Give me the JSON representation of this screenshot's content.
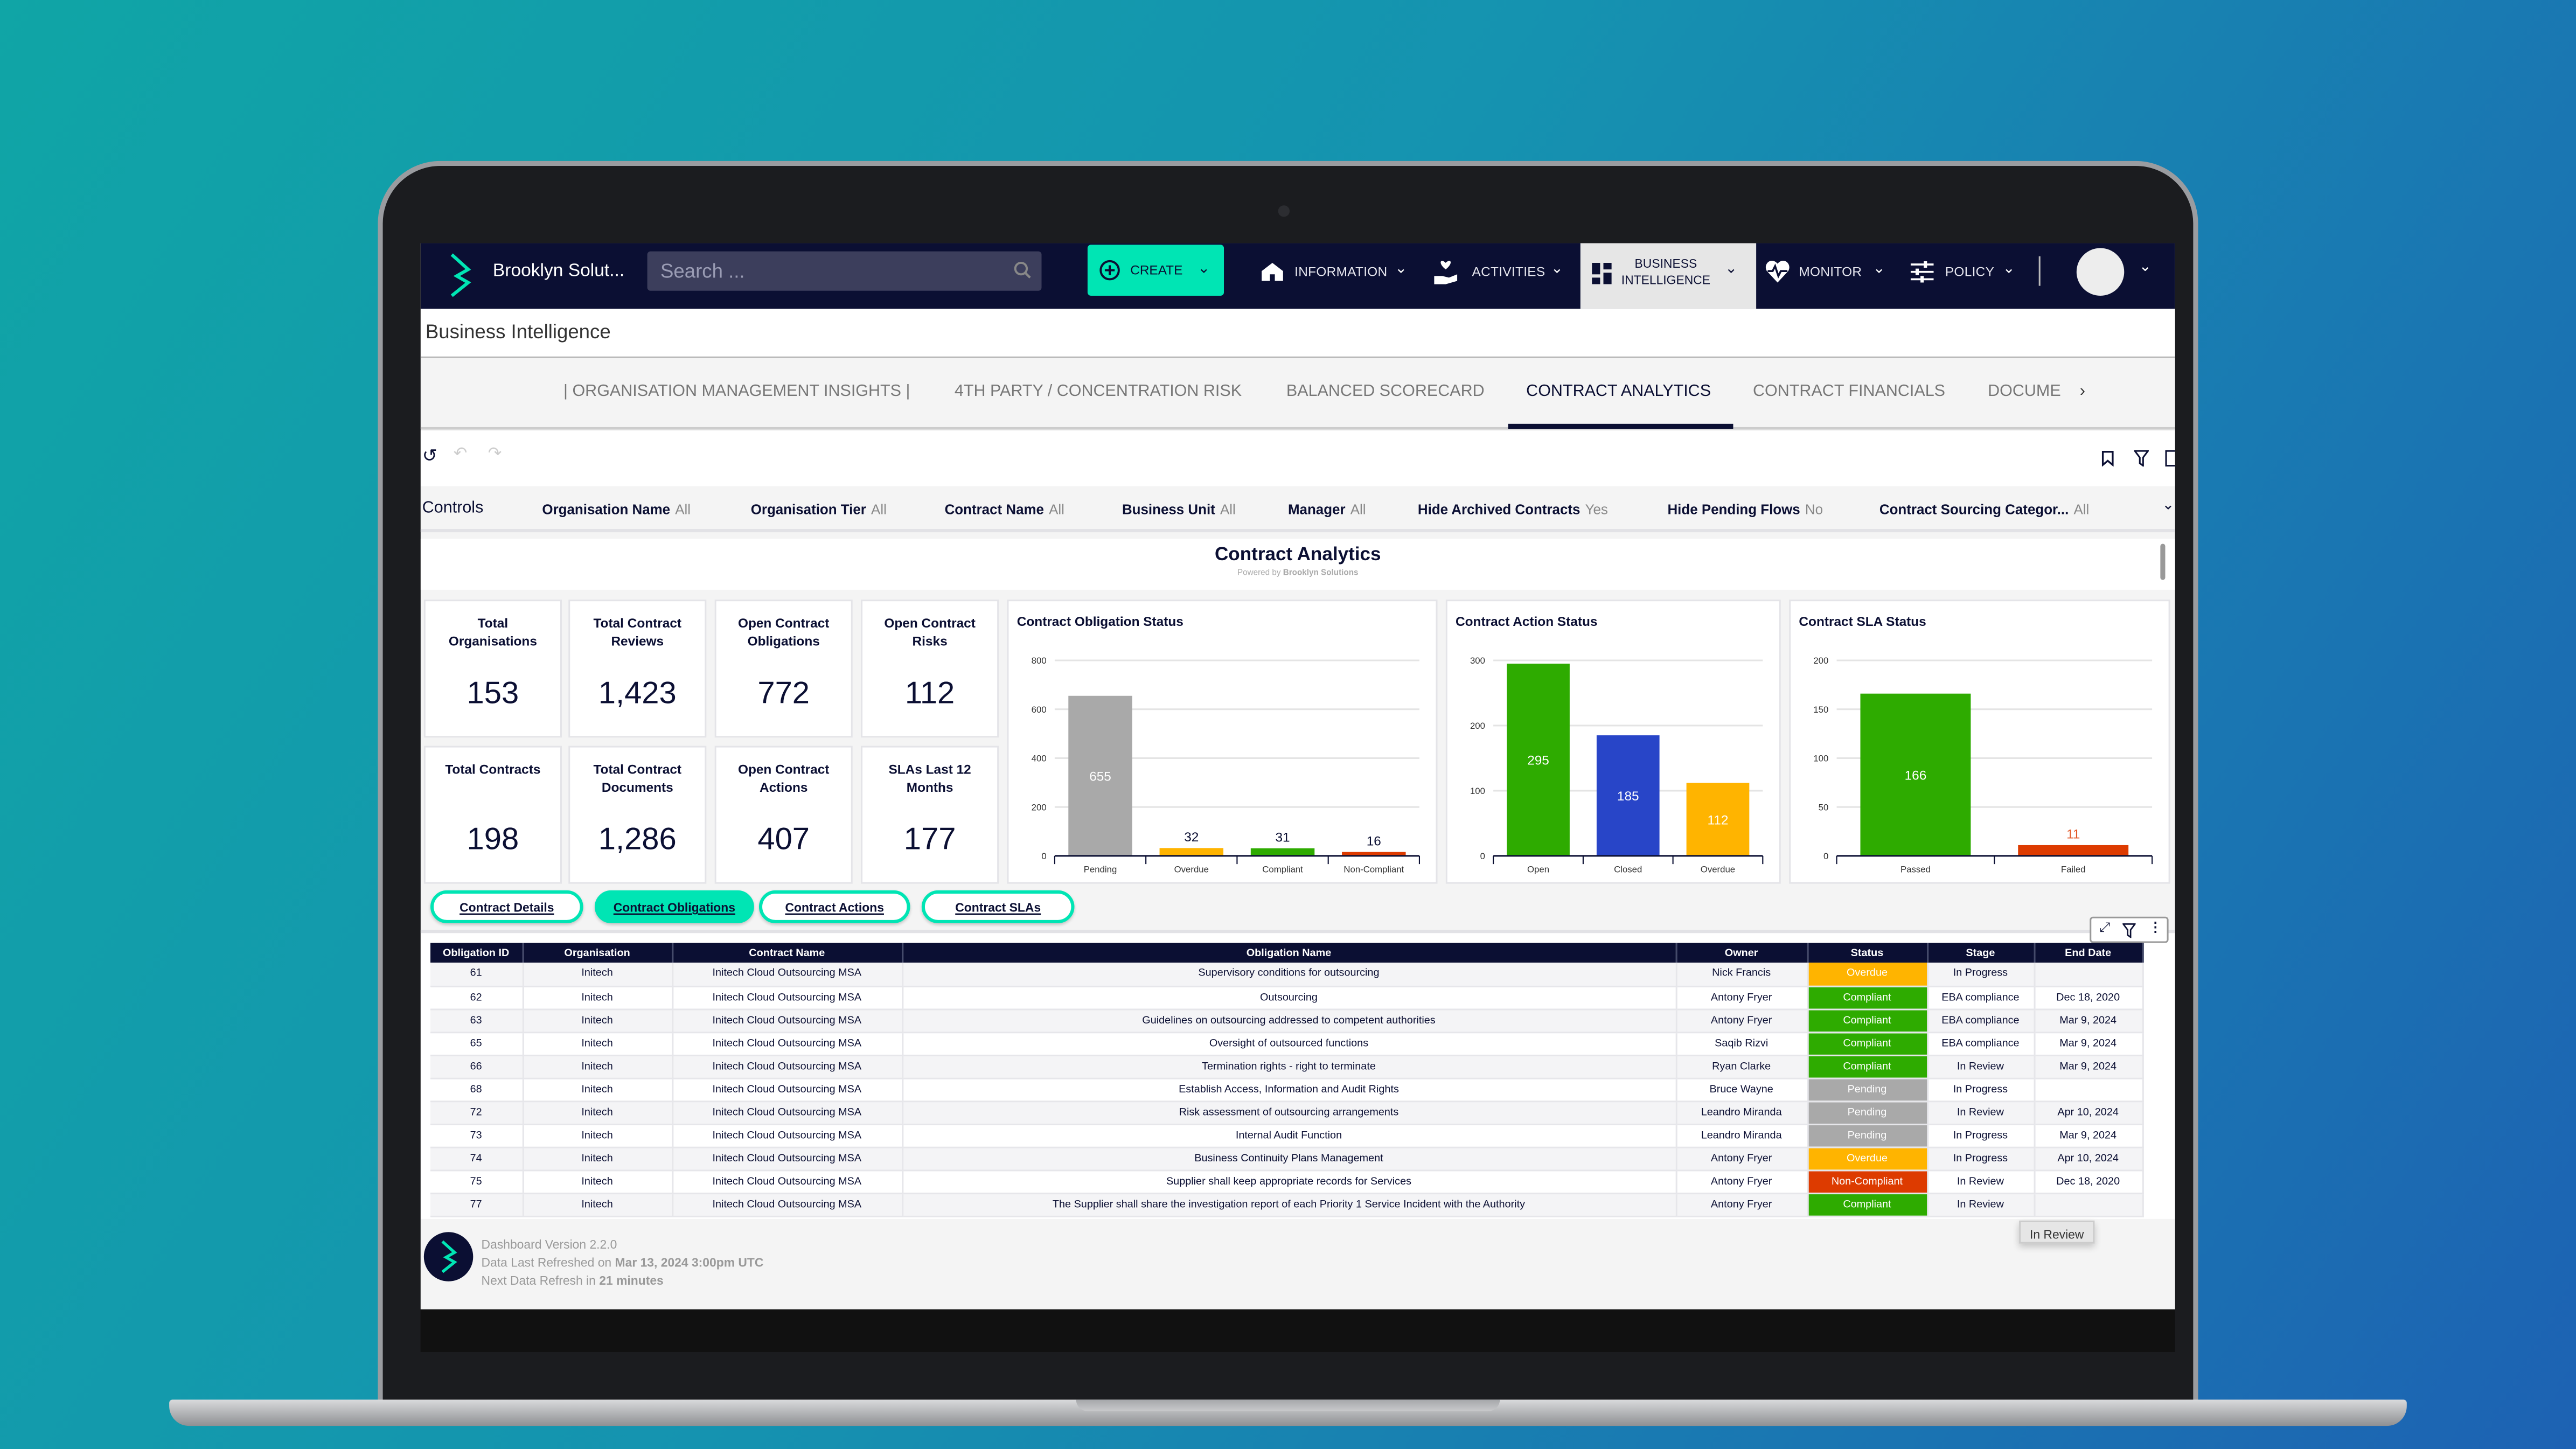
{
  "app": {
    "org_name": "Brooklyn Solut...",
    "search_placeholder": "Search ...",
    "create_label": "CREATE",
    "nav": [
      {
        "label": "INFORMATION",
        "icon": "home-icon"
      },
      {
        "label": "ACTIVITIES",
        "icon": "hand-heart-icon"
      },
      {
        "label": "BUSINESS INTELLIGENCE",
        "icon": "dashboard-icon",
        "active": true
      },
      {
        "label": "MONITOR",
        "icon": "heartbeat-icon"
      },
      {
        "label": "POLICY",
        "icon": "sliders-icon"
      }
    ]
  },
  "page_title": "Business Intelligence",
  "tabs": [
    "| ORGANISATION MANAGEMENT INSIGHTS |",
    "4TH PARTY / CONCENTRATION RISK",
    "BALANCED SCORECARD",
    "CONTRACT ANALYTICS",
    "CONTRACT FINANCIALS",
    "DOCUME"
  ],
  "active_tab": "CONTRACT ANALYTICS",
  "controls": {
    "label": "Controls",
    "filters": [
      {
        "name": "Organisation Name",
        "value": "All"
      },
      {
        "name": "Organisation Tier",
        "value": "All"
      },
      {
        "name": "Contract Name",
        "value": "All"
      },
      {
        "name": "Business Unit",
        "value": "All"
      },
      {
        "name": "Manager",
        "value": "All"
      },
      {
        "name": "Hide Archived Contracts",
        "value": "Yes"
      },
      {
        "name": "Hide Pending Flows",
        "value": "No"
      },
      {
        "name": "Contract Sourcing Categor...",
        "value": "All"
      }
    ]
  },
  "dashboard": {
    "title": "Contract Analytics",
    "powered_prefix": "Powered by",
    "powered_brand": "Brooklyn Solutions"
  },
  "kpis": [
    {
      "label": "Total Organisations",
      "value": "153"
    },
    {
      "label": "Total Contract Reviews",
      "value": "1,423"
    },
    {
      "label": "Open Contract Obligations",
      "value": "772"
    },
    {
      "label": "Open Contract Risks",
      "value": "112"
    },
    {
      "label": "Total Contracts",
      "value": "198"
    },
    {
      "label": "Total Contract Documents",
      "value": "1,286"
    },
    {
      "label": "Open Contract Actions",
      "value": "407"
    },
    {
      "label": "SLAs Last 12 Months",
      "value": "177"
    }
  ],
  "chart_data": [
    {
      "type": "bar",
      "title": "Contract Obligation Status",
      "categories": [
        "Pending",
        "Overdue",
        "Compliant",
        "Non-Compliant"
      ],
      "values": [
        655,
        32,
        31,
        16
      ],
      "colors": [
        "#a9a9a9",
        "#ffb400",
        "#2eab00",
        "#dd3b00"
      ],
      "ylim": [
        0,
        800
      ],
      "yticks": [
        0,
        200,
        400,
        600,
        800
      ],
      "grid": true
    },
    {
      "type": "bar",
      "title": "Contract Action Status",
      "categories": [
        "Open",
        "Closed",
        "Overdue"
      ],
      "values": [
        295,
        185,
        112
      ],
      "colors": [
        "#2eab00",
        "#2845c8",
        "#ffb400"
      ],
      "ylim": [
        0,
        300
      ],
      "yticks": [
        0,
        100,
        200,
        300
      ],
      "grid": true
    },
    {
      "type": "bar",
      "title": "Contract SLA Status",
      "categories": [
        "Passed",
        "Failed"
      ],
      "values": [
        166,
        11
      ],
      "colors": [
        "#2eab00",
        "#dd3b00"
      ],
      "ylim": [
        0,
        200
      ],
      "yticks": [
        0,
        50,
        100,
        150,
        200
      ],
      "grid": true
    }
  ],
  "subtabs": [
    {
      "label": "Contract Details"
    },
    {
      "label": "Contract Obligations",
      "active": true
    },
    {
      "label": "Contract Actions"
    },
    {
      "label": "Contract SLAs"
    }
  ],
  "table": {
    "columns": [
      "Obligation ID",
      "Organisation",
      "Contract Name",
      "Obligation Name",
      "Owner",
      "Status",
      "Stage",
      "End Date"
    ],
    "rows": [
      [
        "61",
        "Initech",
        "Initech Cloud Outsourcing MSA",
        "Supervisory conditions for outsourcing",
        "Nick Francis",
        "Overdue",
        "In Progress",
        ""
      ],
      [
        "62",
        "Initech",
        "Initech Cloud Outsourcing MSA",
        "Outsourcing",
        "Antony Fryer",
        "Compliant",
        "EBA compliance",
        "Dec 18, 2020"
      ],
      [
        "63",
        "Initech",
        "Initech Cloud Outsourcing MSA",
        "Guidelines on outsourcing addressed to competent authorities",
        "Antony Fryer",
        "Compliant",
        "EBA compliance",
        "Mar 9, 2024"
      ],
      [
        "65",
        "Initech",
        "Initech Cloud Outsourcing MSA",
        "Oversight of outsourced functions",
        "Saqib Rizvi",
        "Compliant",
        "EBA compliance",
        "Mar 9, 2024"
      ],
      [
        "66",
        "Initech",
        "Initech Cloud Outsourcing MSA",
        "Termination rights - right to terminate",
        "Ryan Clarke",
        "Compliant",
        "In Review",
        "Mar 9, 2024"
      ],
      [
        "68",
        "Initech",
        "Initech Cloud Outsourcing MSA",
        "Establish Access, Information and Audit Rights",
        "Bruce Wayne",
        "Pending",
        "In Progress",
        ""
      ],
      [
        "72",
        "Initech",
        "Initech Cloud Outsourcing MSA",
        "Risk assessment of outsourcing arrangements",
        "Leandro Miranda",
        "Pending",
        "In Review",
        "Apr 10, 2024"
      ],
      [
        "73",
        "Initech",
        "Initech Cloud Outsourcing MSA",
        "Internal Audit Function",
        "Leandro Miranda",
        "Pending",
        "In Progress",
        "Mar 9, 2024"
      ],
      [
        "74",
        "Initech",
        "Initech Cloud Outsourcing MSA",
        "Business Continuity Plans Management",
        "Antony Fryer",
        "Overdue",
        "In Progress",
        "Apr 10, 2024"
      ],
      [
        "75",
        "Initech",
        "Initech Cloud Outsourcing MSA",
        "Supplier shall keep appropriate records for Services",
        "Antony Fryer",
        "Non-Compliant",
        "In Review",
        "Dec 18, 2020"
      ],
      [
        "77",
        "Initech",
        "Initech Cloud Outsourcing MSA",
        "The Supplier shall share the investigation report of each Priority 1 Service Incident with the Authority",
        "Antony Fryer",
        "Compliant",
        "In Review",
        ""
      ]
    ]
  },
  "status_colors": {
    "Overdue": "#ffb400",
    "Compliant": "#2eab00",
    "Pending": "#a9a9a9",
    "Non-Compliant": "#dd3b00"
  },
  "tooltip": "In Review",
  "footer": {
    "version": "Dashboard Version 2.2.0",
    "refreshed_prefix": "Data Last Refreshed on",
    "refreshed_value": "Mar 13, 2024 3:00pm UTC",
    "next_prefix": "Next Data Refresh in",
    "next_value": "21 minutes"
  },
  "colors": {
    "nav": "#0b0f33",
    "accent": "#00e5b4"
  }
}
